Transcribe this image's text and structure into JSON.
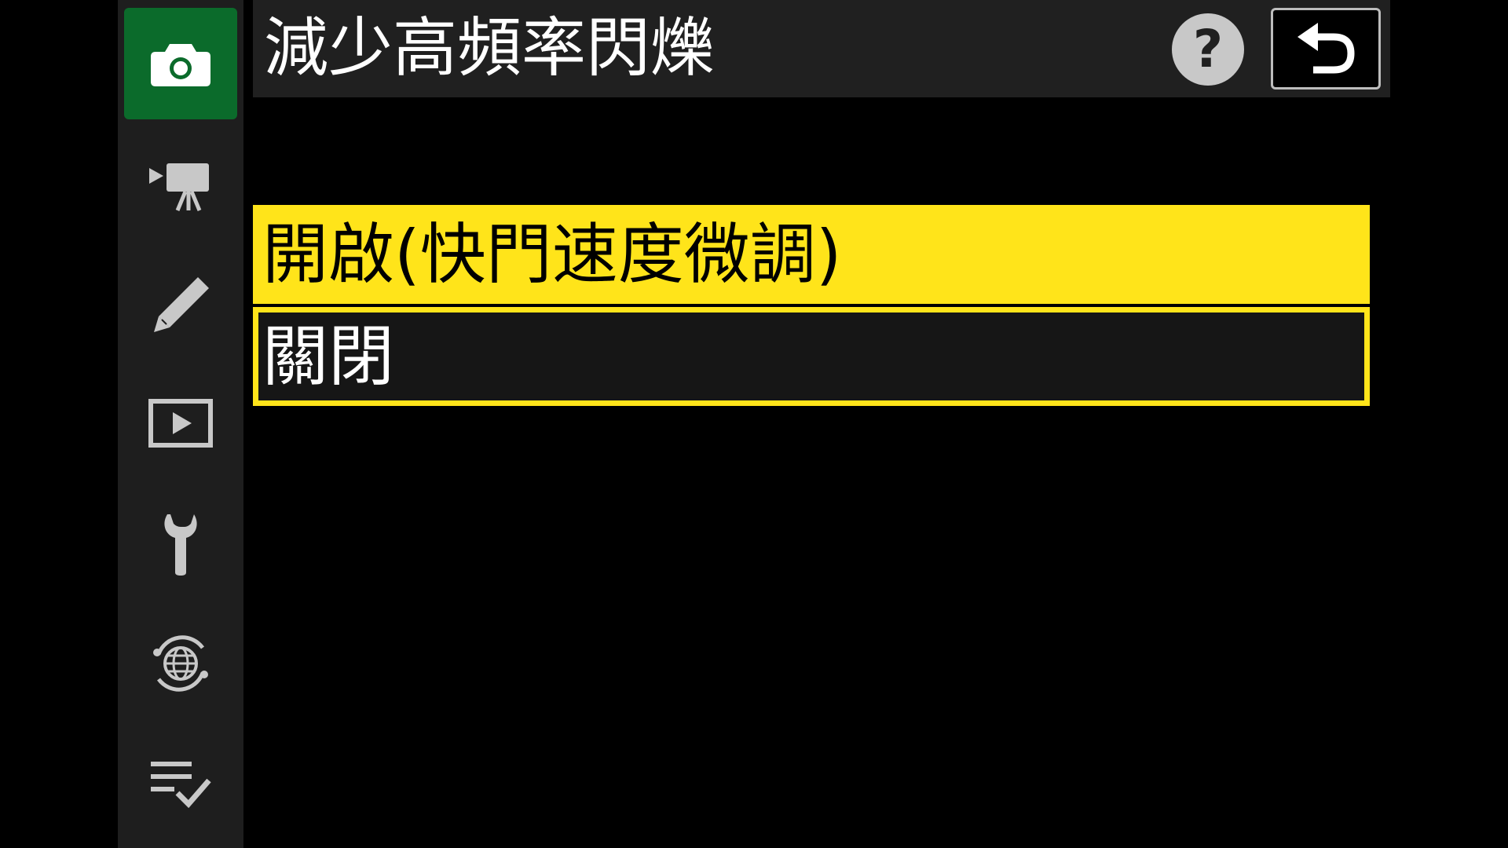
{
  "header": {
    "title": "減少高頻率閃爍",
    "help_label": "?",
    "back_icon": "return-arrow-icon"
  },
  "sidebar": {
    "items": [
      {
        "name": "photo-shooting",
        "icon": "camera-icon",
        "active": true
      },
      {
        "name": "movie-recording",
        "icon": "movie-camera-icon",
        "active": false
      },
      {
        "name": "custom-settings",
        "icon": "pencil-icon",
        "active": false
      },
      {
        "name": "playback",
        "icon": "playback-icon",
        "active": false
      },
      {
        "name": "setup",
        "icon": "wrench-icon",
        "active": false
      },
      {
        "name": "network",
        "icon": "network-globe-icon",
        "active": false
      },
      {
        "name": "my-menu",
        "icon": "my-menu-checklist-icon",
        "active": false
      }
    ]
  },
  "options": [
    {
      "label": "開啟(快門速度微調)",
      "highlighted": true
    },
    {
      "label": "關閉",
      "selected": true
    }
  ],
  "colors": {
    "highlight": "#ffe41a",
    "active_tab": "#0b6b2b",
    "sidebar_bg": "#1e1e1e",
    "header_bg": "#202020"
  }
}
